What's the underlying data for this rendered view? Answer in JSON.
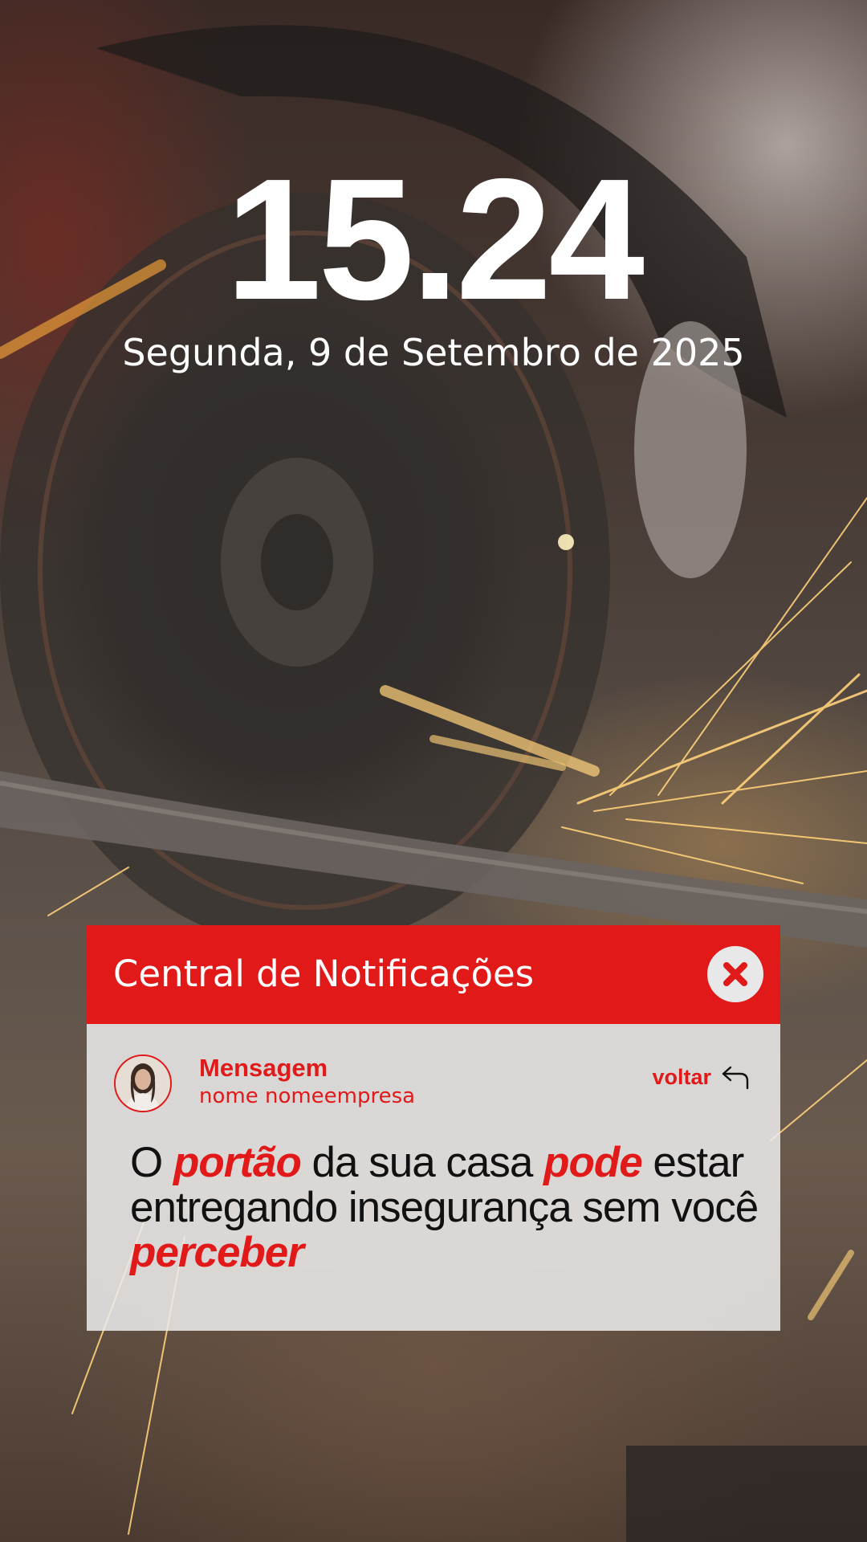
{
  "lock_screen": {
    "time": "15.24",
    "date": "Segunda, 9 de Setembro de 2025"
  },
  "notification_center": {
    "title": "Central de Notificações",
    "close_icon": "close-icon",
    "message": {
      "sender_label": "Mensagem",
      "sender_name": "nome nomeempresa",
      "avatar_icon": "avatar",
      "back_label": "voltar",
      "back_icon": "reply-arrow-icon",
      "text_parts": [
        "O ",
        "portão",
        " da sua casa ",
        "pode",
        " estar entregando insegurança sem você ",
        "perceber"
      ]
    }
  },
  "colors": {
    "accent": "#e11919",
    "panel_bg": "#ececec",
    "text_dark": "#111111"
  }
}
